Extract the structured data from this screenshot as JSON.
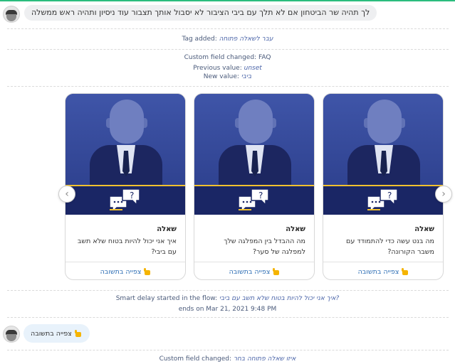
{
  "top_message": "לך תהיה שר הביטחון אם לא תלך עם ביבי הציבור לא יסבול אותך תצבור עוד ניסיון ותהיה ראש ממשלה",
  "tag_event": {
    "label": "Tag added:",
    "value": "עבר לשאלה פתוחה"
  },
  "field_event": {
    "label": "Custom field changed:",
    "field": "FAQ",
    "prev_label": "Previous value:",
    "prev_value": "unset",
    "new_label": "New value:",
    "new_value": "ביבי"
  },
  "cards": [
    {
      "title": "שאלה",
      "desc": "מה בנט עשה כדי להתמודד עם משבר הקורונה?",
      "button": "צפייה בתשובה"
    },
    {
      "title": "שאלה",
      "desc": "מה ההבדל בין המפלגה שלך למפלגה של סער?",
      "button": "צפייה בתשובה"
    },
    {
      "title": "שאלה",
      "desc": "איך אני יכול להיות בטוח שלא תשב עם ביבי?",
      "button": "צפייה בתשובה"
    }
  ],
  "delay_event": {
    "label": "Smart delay started in the flow:",
    "flow": "איך אני יכול להיות בטוח שלא תשב עם ביבי?",
    "ends": "ends on Mar 21, 2021 9:48 PM"
  },
  "reply": {
    "label": "צפייה בתשובה"
  },
  "bottom_event": {
    "label": "Custom field changed:",
    "value": "איזו שאלה פתוחה בחר"
  },
  "colors": {
    "accent": "#2bbd7e",
    "card_blue": "#2d3f8f",
    "link": "#2f6fb5",
    "yellow": "#f2c12e"
  },
  "icons": [
    "user-avatar-icon",
    "pointing-hand-icon",
    "chevron-left-icon",
    "chevron-right-icon",
    "speech-bubbles-icon"
  ]
}
